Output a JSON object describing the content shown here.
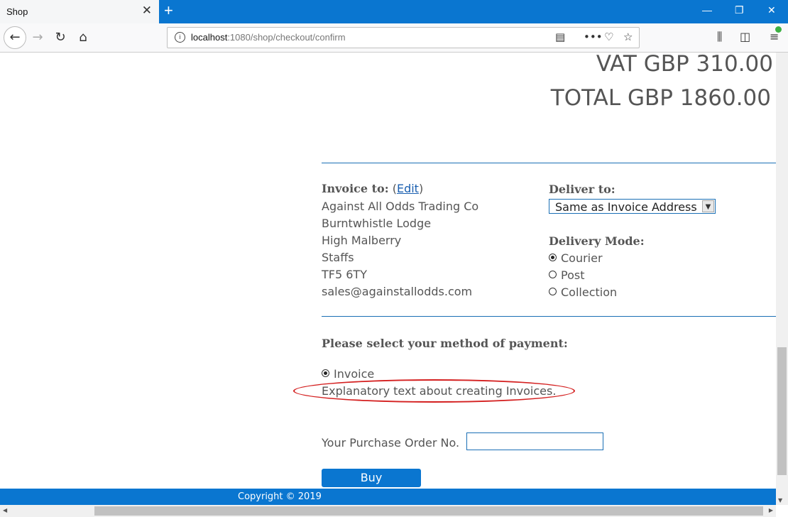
{
  "browser": {
    "tab_title": "Shop",
    "tab_close": "✕",
    "new_tab": "+",
    "url_host": "localhost",
    "url_path": ":1080/shop/checkout/confirm",
    "win_min": "—",
    "win_restore": "❐",
    "win_close": "✕"
  },
  "totals": {
    "vat": "VAT GBP 310.00",
    "total": "TOTAL GBP 1860.00"
  },
  "invoice": {
    "heading": "Invoice to:",
    "edit_open": "(",
    "edit_label": "Edit",
    "edit_close": ")",
    "lines": [
      "Against All Odds Trading Co",
      "Burntwhistle Lodge",
      "High Malberry",
      "Staffs",
      "TF5 6TY",
      "sales@againstallodds.com"
    ]
  },
  "delivery": {
    "heading": "Deliver to:",
    "selected": "Same as Invoice Address",
    "mode_heading": "Delivery Mode:",
    "modes": [
      "Courier",
      "Post",
      "Collection"
    ],
    "selected_mode": "Courier"
  },
  "payment": {
    "heading": "Please select your method of payment:",
    "method": "Invoice",
    "explanation": "Explanatory text about creating Invoices.",
    "po_label": "Your Purchase Order No.",
    "po_value": "",
    "buy_label": "Buy"
  },
  "footer": {
    "copyright": "Copyright © 2019"
  },
  "colors": {
    "brand_blue": "#0a76d0",
    "rule_blue": "#1a6fb5",
    "annotation_red": "#d42020"
  }
}
